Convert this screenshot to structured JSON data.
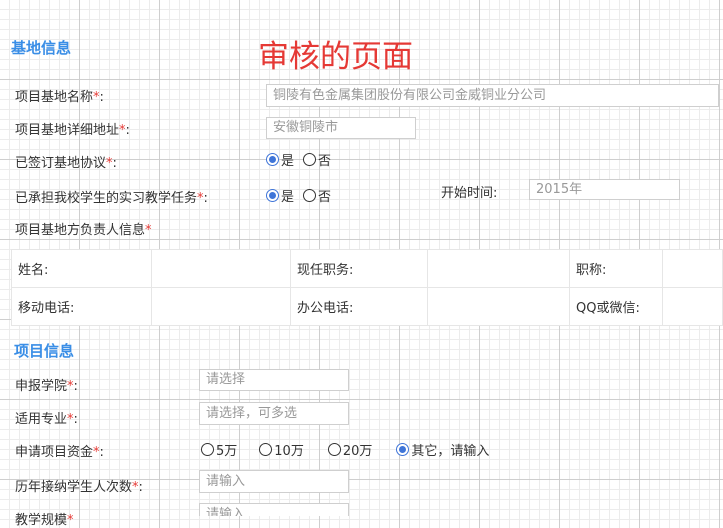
{
  "page_title": "审核的页面",
  "colors": {
    "section": "#3a8ee6",
    "title": "#e53935",
    "radio_checked": "#3f75d8",
    "required": "#e53935"
  },
  "base_info": {
    "heading": "基地信息",
    "name_label": "项目基地名称",
    "name_value": "铜陵有色金属集团股份有限公司金威铜业分公司",
    "address_label": "项目基地详细地址",
    "address_value": "安徽铜陵市",
    "agreement_label": "已签订基地协议",
    "agreement_options": [
      "是",
      "否"
    ],
    "teaching_task_label": "已承担我校学生的实习教学任务",
    "teaching_task_options": [
      "是",
      "否"
    ],
    "start_time_label": "开始时间:",
    "start_time_value": "2015年",
    "leader_label": "项目基地方负责人信息",
    "leader_table": [
      [
        "姓名:",
        "",
        "现任职务:",
        "",
        "职称:",
        ""
      ],
      [
        "移动电话:",
        "",
        "办公电话:",
        "",
        "QQ或微信:",
        ""
      ]
    ]
  },
  "project_info": {
    "heading": "项目信息",
    "college_label": "申报学院",
    "college_placeholder": "请选择",
    "major_label": "适用专业",
    "major_placeholder": "请选择，可多选",
    "funding_label": "申请项目资金",
    "funding_options": [
      "5万",
      "10万",
      "20万",
      "其它，请输入"
    ],
    "students_label": "历年接纳学生人次数",
    "students_placeholder": "请输入",
    "scale_label": "教学规模",
    "scale_placeholder": "请输入"
  },
  "required_mark": "*",
  "colon": ":"
}
